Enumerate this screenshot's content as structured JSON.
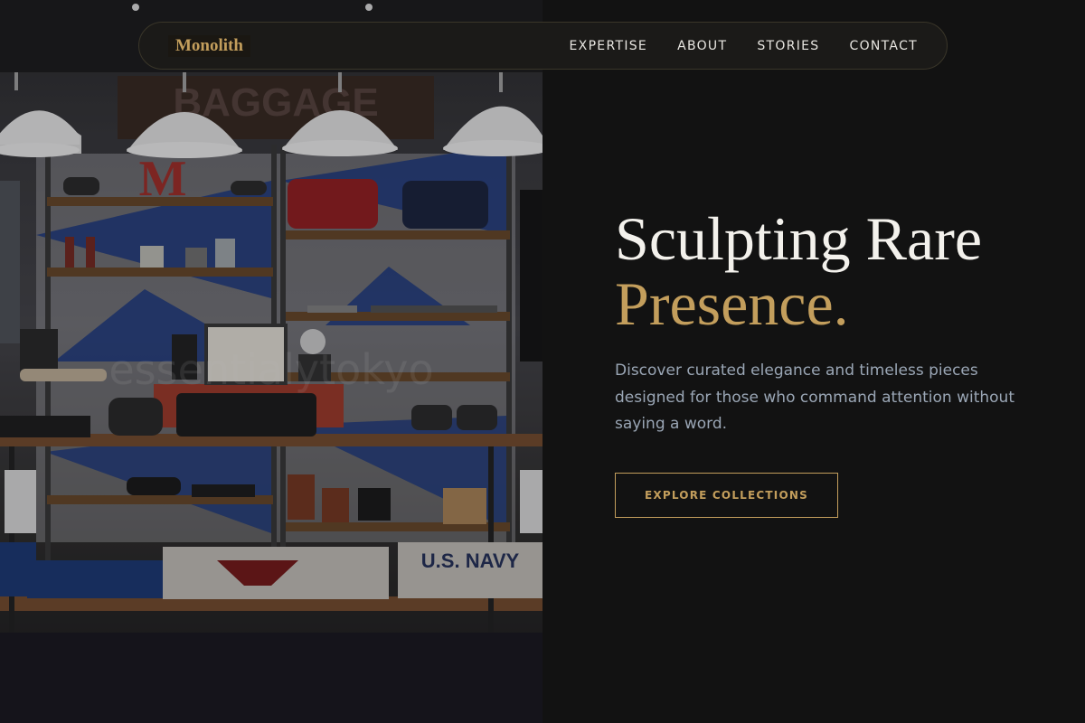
{
  "brand": {
    "logo_text": "Monolith"
  },
  "nav": {
    "items": [
      {
        "label": "EXPERTISE"
      },
      {
        "label": "ABOUT"
      },
      {
        "label": "STORIES"
      },
      {
        "label": "CONTACT"
      }
    ]
  },
  "hero": {
    "title_line1": "Sculpting Rare",
    "title_line2": "Presence.",
    "description": "Discover curated elegance and timeless pieces designed for those who command attention without saying a word.",
    "cta_label": "EXPLORE COLLECTIONS"
  },
  "photo": {
    "watermark": "essentialytokyo",
    "shelf_sign": "BAGGAGE",
    "shelf_letter": "M",
    "shirt_print": "U.S. NAVY"
  },
  "colors": {
    "accent": "#c39e5c",
    "panel_background": "#121212",
    "body_text": "#9aa6b5",
    "title_text": "#f3f1ec"
  }
}
